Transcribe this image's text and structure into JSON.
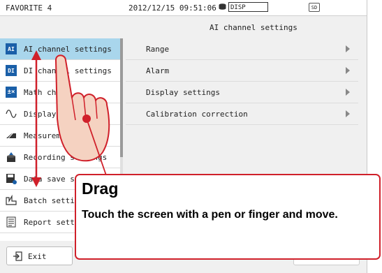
{
  "status": {
    "favorite": "FAVORITE 4",
    "datetime": "2012/12/15 09:51:06",
    "disp": "DISP",
    "sd": "SD"
  },
  "page_title": "AI channel settings",
  "menu": {
    "items": [
      {
        "label": "AI channel settings",
        "icon": "ai-icon",
        "selected": true
      },
      {
        "label": "DI channel settings",
        "icon": "di-icon"
      },
      {
        "label": "Math ch",
        "icon": "math-icon"
      },
      {
        "label": "Display se",
        "icon": "sine-wave-icon"
      },
      {
        "label": "Measurement s",
        "icon": "measurement-icon"
      },
      {
        "label": "Recording settings",
        "icon": "recording-icon"
      },
      {
        "label": "Data save se",
        "icon": "data-save-icon"
      },
      {
        "label": "Batch setting",
        "icon": "batch-icon"
      },
      {
        "label": "Report settin",
        "icon": "report-icon"
      }
    ]
  },
  "submenu": {
    "items": [
      {
        "label": "Range"
      },
      {
        "label": "Alarm"
      },
      {
        "label": "Display settings"
      },
      {
        "label": "Calibration correction"
      }
    ]
  },
  "footer": {
    "exit_label": "Exit"
  },
  "callout": {
    "title": "Drag",
    "body": "Touch the screen with a pen or finger and move."
  },
  "colors": {
    "selected_bg": "#a9d6ec",
    "icon_blue": "#1a5fa8",
    "callout_red": "#d0202a",
    "arrow_red": "#d0202a"
  }
}
